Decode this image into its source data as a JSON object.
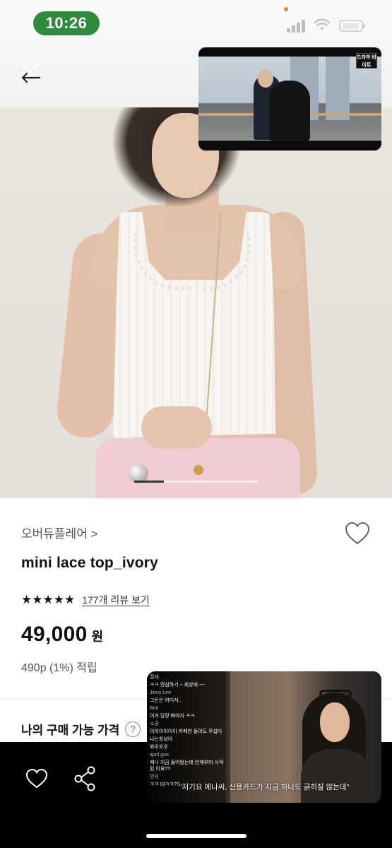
{
  "status_bar": {
    "time": "10:26"
  },
  "pip_top": {
    "logo_text": "드라마 바이트"
  },
  "pip_bottom": {
    "chat": [
      {
        "user": "절세",
        "text": ""
      },
      {
        "user": "",
        "text": "ㅋㅋ 명심하기 ~ 세상에 ~~"
      },
      {
        "user": "Jinny Lee",
        "text": "그돈은 어디서.."
      },
      {
        "user": "Brie",
        "text": "이거 당장 봐야지 ㅋㅋ"
      },
      {
        "user": "소쿵",
        "text": "이이이이이이 카페한 돌이도 무섭다"
      },
      {
        "user": "",
        "text": "나는최남이"
      },
      {
        "user": "",
        "text": "와오오오"
      },
      {
        "user": "april goo",
        "text": "제니 지금 들어왔는데 언제부터 시작된 이요??"
      },
      {
        "user": "민지",
        "text": "ㅋㅋ 대ㅋㅋ??"
      }
    ],
    "subtitle": "\"저기요 에나씨, 신용카드가 지금 하나도 긁히질 않는데\""
  },
  "product": {
    "brand": "오버듀플레어 >",
    "name": "mini lace top_ivory",
    "stars": "★★★★★",
    "rating": 5,
    "review_link": "177개 리뷰 보기",
    "price": "49,000",
    "currency": "원",
    "points": "490p (1%) 적립",
    "my_price_label": "나의 구매 가능 가격",
    "help_symbol": "?"
  },
  "colors": {
    "status_pill": "#2e8b3b",
    "bottom_bar": "#000000",
    "pants": "#efcdd2"
  },
  "icons": {
    "back": "back-arrow-icon",
    "wish": "heart-outline-icon",
    "like": "heart-outline-icon",
    "share": "share-icon"
  }
}
